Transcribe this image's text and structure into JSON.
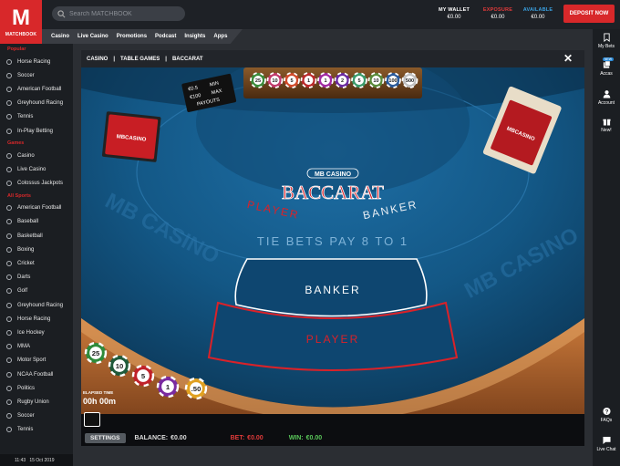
{
  "brand": {
    "logo_letter": "M",
    "logo_text": "MATCHBOOK"
  },
  "search": {
    "placeholder": "Search MATCHBOOK"
  },
  "wallet": [
    {
      "label": "MY WALLET",
      "value": "€0.00",
      "color": "#ffffff"
    },
    {
      "label": "EXPOSURE",
      "value": "€0.00",
      "color": "#e03a3a"
    },
    {
      "label": "AVAILABLE",
      "value": "€0.00",
      "color": "#3aa0e0"
    }
  ],
  "deposit_label": "DEPOSIT NOW",
  "nav_tabs": [
    "Casino",
    "Live Casino",
    "Promotions",
    "Podcast",
    "Insights",
    "Apps"
  ],
  "sidebar": {
    "sections": [
      {
        "title": "Popular",
        "items": [
          "Horse Racing",
          "Soccer",
          "American Football",
          "Greyhound Racing",
          "Tennis",
          "In-Play Betting"
        ]
      },
      {
        "title": "Games",
        "items": [
          "Casino",
          "Live Casino",
          "Colossus Jackpots"
        ]
      },
      {
        "title": "All Sports",
        "items": [
          "American Football",
          "Baseball",
          "Basketball",
          "Boxing",
          "Cricket",
          "Darts",
          "Golf",
          "Greyhound Racing",
          "Horse Racing",
          "Ice Hockey",
          "MMA",
          "Motor Sport",
          "NCAA Football",
          "Politics",
          "Rugby Union",
          "Soccer",
          "Tennis"
        ]
      }
    ]
  },
  "datetime": {
    "time": "11:43",
    "date": "15 Oct 2019"
  },
  "right_rail": [
    {
      "label": "My Bets",
      "icon": "bookmark-icon"
    },
    {
      "label": "Accas",
      "icon": "accas-icon",
      "badge": "NEW"
    },
    {
      "label": "Account",
      "icon": "account-icon"
    },
    {
      "label": "New!",
      "icon": "gift-icon"
    },
    {
      "label": "FAQs",
      "icon": "faq-icon"
    },
    {
      "label": "Live Chat",
      "icon": "chat-icon"
    }
  ],
  "modal": {
    "breadcrumb": [
      "CASINO",
      "|",
      "TABLE GAMES",
      "|",
      "BACCARAT"
    ],
    "close": "✕"
  },
  "game": {
    "brand_badge": "MB CASINO",
    "title": "BACCARAT",
    "player_word": "PLAYER",
    "banker_word": "BANKER",
    "tie_text": "TIE BETS PAY 8 TO 1",
    "banker_box": "BANKER",
    "player_box": "PLAYER",
    "limits": [
      "€0.5",
      "MIN",
      "€100",
      "MAX",
      "PAYOUTS"
    ],
    "card_brand": "MBCASINO",
    "chips": [
      {
        "label": "25",
        "color": "#2f8a3a"
      },
      {
        "label": "10",
        "color": "#1f5a3a"
      },
      {
        "label": "5",
        "color": "#c0222a"
      },
      {
        "label": "1",
        "color": "#7a2aa0"
      },
      {
        "label": ".50",
        "color": "#e0a020"
      }
    ],
    "tray_chips": [
      {
        "label": "25",
        "color": "#3a8a3a"
      },
      {
        "label": "10",
        "color": "#c03a6a"
      },
      {
        "label": "5",
        "color": "#d04a2a"
      },
      {
        "label": "1",
        "color": "#b82a2a"
      },
      {
        "label": "1",
        "color": "#a02aa0"
      },
      {
        "label": "2",
        "color": "#6a2aa0"
      },
      {
        "label": "5",
        "color": "#3a9a6a"
      },
      {
        "label": "10",
        "color": "#5a8a3a"
      },
      {
        "label": "100",
        "color": "#2a5a9a"
      },
      {
        "label": "500",
        "color": "#c0c0c0"
      }
    ],
    "elapsed_label": "ELAPSED TIME",
    "elapsed_value": "00h 00m",
    "settings_label": "SETTINGS",
    "balance_label": "BALANCE:",
    "balance_value": "€0.00",
    "bet_label": "BET:",
    "bet_value": "€0.00",
    "win_label": "WIN:",
    "win_value": "€0.00"
  }
}
